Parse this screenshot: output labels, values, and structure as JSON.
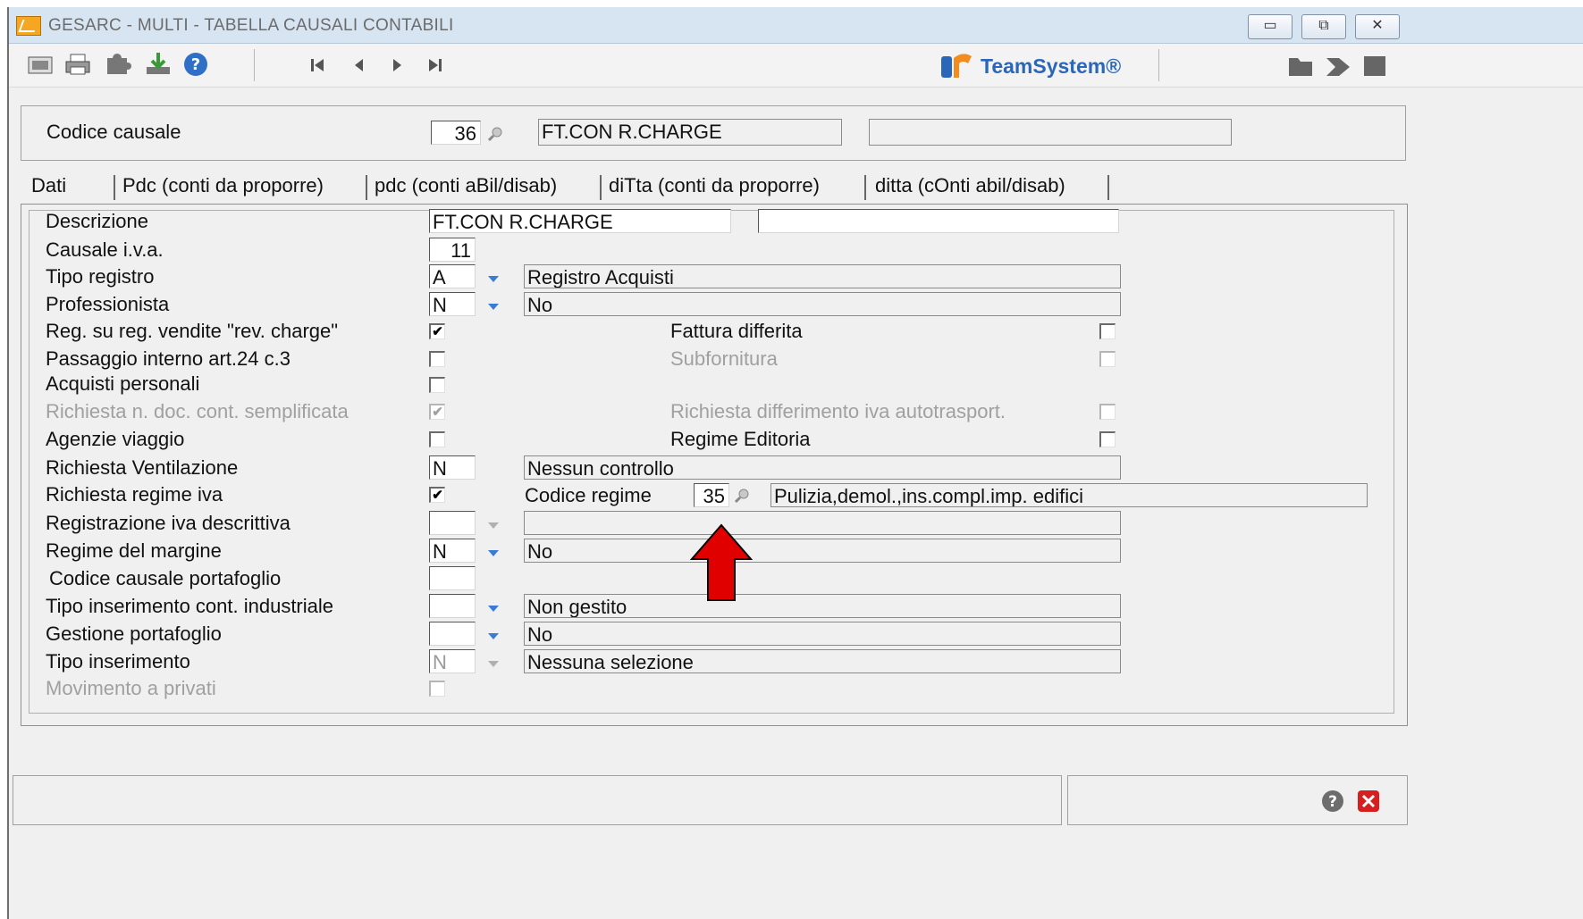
{
  "window": {
    "title": "GESARC  - MULTI -  TABELLA CAUSALI CONTABILI",
    "controls": [
      "minimize",
      "maximize",
      "close"
    ]
  },
  "toolbar": {
    "left_icons": [
      "screen-icon",
      "printer-icon",
      "puzzle-icon",
      "download-icon",
      "help-icon"
    ],
    "nav_icons": [
      "first-icon",
      "prev-icon",
      "next-icon",
      "last-icon"
    ],
    "brand": "TeamSystem®",
    "right_icons": [
      "folder-icon",
      "forward-icon",
      "stop-icon"
    ]
  },
  "header": {
    "codice_label": "Codice causale",
    "codice_value": "36",
    "descr_value": "FT.CON R.CHARGE",
    "extra_value": ""
  },
  "tabs": [
    {
      "label": "Dati"
    },
    {
      "label": "Pdc (conti da proporre)"
    },
    {
      "label": "pdc (conti aBil/disab)"
    },
    {
      "label": "diTta (conti da proporre)"
    },
    {
      "label": "ditta (cOnti abil/disab)"
    }
  ],
  "form": {
    "descrizione": {
      "label": "Descrizione",
      "value": "FT.CON R.CHARGE",
      "value2": ""
    },
    "causale_iva": {
      "label": "Causale i.v.a.",
      "value": "11"
    },
    "tipo_registro": {
      "label": "Tipo registro",
      "code": "A",
      "desc": "Registro Acquisti"
    },
    "professionista": {
      "label": "Professionista",
      "code": "N",
      "desc": "No"
    },
    "reg_vendite": {
      "label": "Reg. su reg. vendite \"rev. charge\"",
      "checked": "✔"
    },
    "fattura_differita": {
      "label": "Fattura differita",
      "checked": ""
    },
    "passaggio_interno": {
      "label": "Passaggio interno art.24 c.3",
      "checked": ""
    },
    "subfornitura": {
      "label": "Subfornitura",
      "checked": ""
    },
    "acquisti_personali": {
      "label": "Acquisti personali",
      "checked": ""
    },
    "richiesta_ndoc": {
      "label": "Richiesta n. doc. cont. semplificata",
      "checked": "✔"
    },
    "richiesta_differimento": {
      "label": "Richiesta differimento iva autotrasport.",
      "checked": ""
    },
    "agenzie_viaggio": {
      "label": "Agenzie viaggio",
      "checked": ""
    },
    "regime_editoria": {
      "label": "Regime Editoria",
      "checked": ""
    },
    "richiesta_ventilazione": {
      "label": "Richiesta Ventilazione",
      "code": "N",
      "desc": "Nessun controllo"
    },
    "richiesta_regime_iva": {
      "label": "Richiesta regime iva",
      "checked": "✔"
    },
    "codice_regime": {
      "label": "Codice regime",
      "value": "35",
      "desc": "Pulizia,demol.,ins.compl.imp. edifici"
    },
    "registrazione_descrittiva": {
      "label": "Registrazione iva descrittiva",
      "code": "",
      "desc": ""
    },
    "regime_margine": {
      "label": "Regime del margine",
      "code": "N",
      "desc": "No"
    },
    "codice_portafoglio": {
      "label": "Codice causale portafoglio",
      "value": ""
    },
    "tipo_inserimento_ci": {
      "label": "Tipo inserimento cont. industriale",
      "code": "",
      "desc": "Non gestito"
    },
    "gestione_portafoglio": {
      "label": "Gestione portafoglio",
      "code": "",
      "desc": "No"
    },
    "tipo_inserimento": {
      "label": "Tipo inserimento",
      "code": "N",
      "desc": "Nessuna selezione"
    },
    "movimento_privati": {
      "label": "Movimento a privati",
      "checked": ""
    }
  },
  "colors": {
    "accent_arrow": "#e00000",
    "titlebar": "#d7e4f2",
    "brand": "#2a67b8"
  }
}
